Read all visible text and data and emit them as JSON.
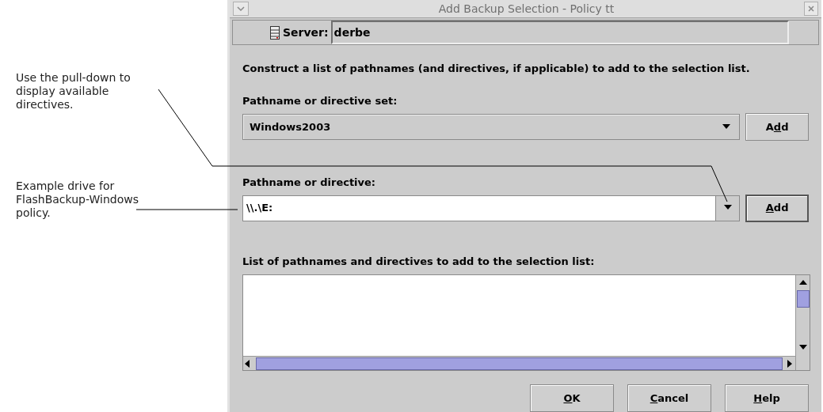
{
  "annotations": [
    {
      "text": "Use the pull-down to display available directives."
    },
    {
      "text": "Example drive for FlashBackup-Windows policy."
    }
  ],
  "window": {
    "title": "Add Backup Selection - Policy tt"
  },
  "server": {
    "label": "Server:",
    "value": "derbe"
  },
  "instructions": "Construct a list of pathnames (and directives, if applicable) to add to the selection list.",
  "directive_set": {
    "label": "Pathname or directive set:",
    "value": "Windows2003",
    "add_button": [
      {
        "text": "A",
        "underline": false
      },
      {
        "text": "d",
        "underline": true
      },
      {
        "text": "d",
        "underline": false
      }
    ]
  },
  "directive": {
    "label": "Pathname or directive:",
    "value": "\\\\.\\E:",
    "add_button": [
      {
        "text": "A",
        "underline": true
      },
      {
        "text": "dd",
        "underline": false
      }
    ]
  },
  "list": {
    "label": "List of pathnames and directives to add to the selection list:"
  },
  "buttons": [
    [
      {
        "text": "O",
        "underline": true
      },
      {
        "text": "K",
        "underline": false
      }
    ],
    [
      {
        "text": "C",
        "underline": true
      },
      {
        "text": "ancel",
        "underline": false
      }
    ],
    [
      {
        "text": "H",
        "underline": true
      },
      {
        "text": "elp",
        "underline": false
      }
    ]
  ]
}
